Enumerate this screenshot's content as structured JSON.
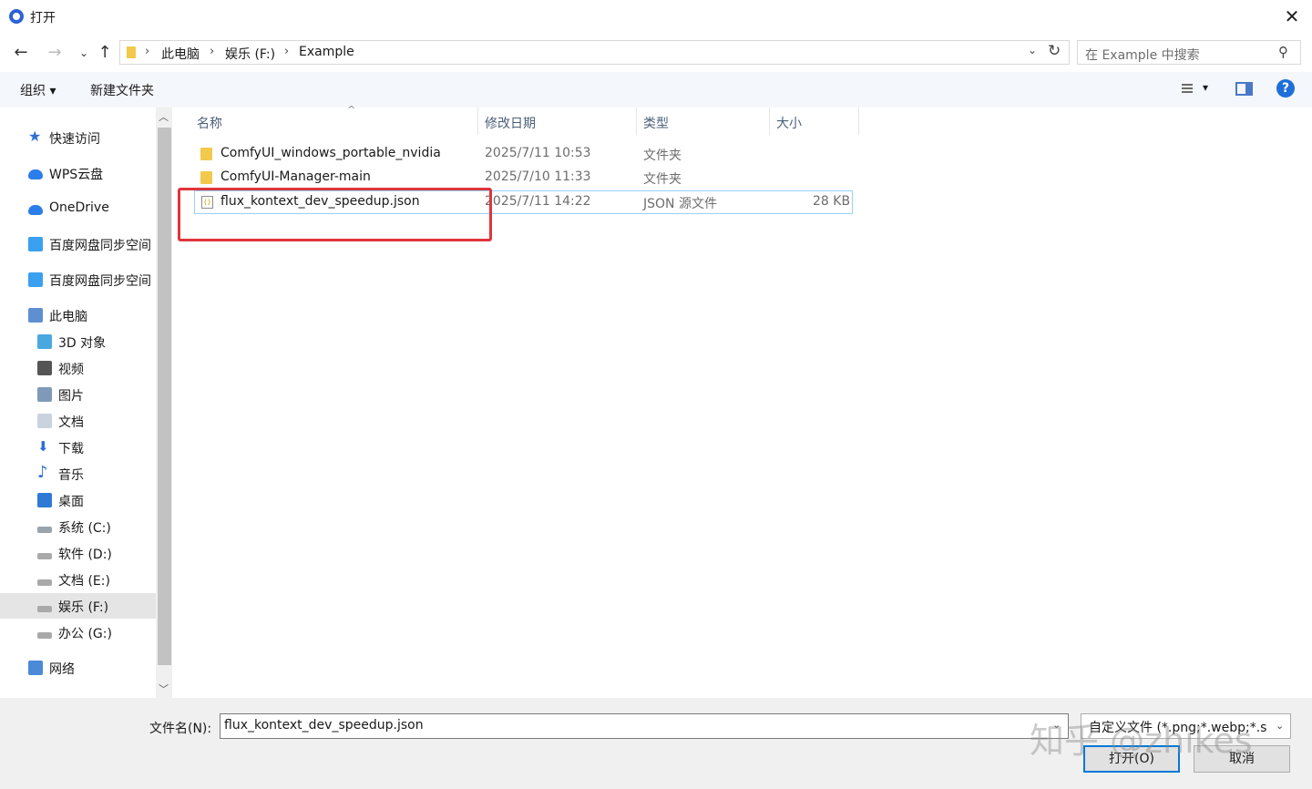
{
  "window": {
    "title": "打开"
  },
  "navigation": {
    "breadcrumbs": [
      "此电脑",
      "娱乐 (F:)",
      "Example"
    ],
    "search_placeholder": "在 Example 中搜索"
  },
  "toolbar": {
    "organize_label": "组织 ▾",
    "new_folder_label": "新建文件夹"
  },
  "sidebar": {
    "items": [
      {
        "label": "快速访问",
        "icon": "star-icon"
      },
      {
        "label": "WPS云盘",
        "icon": "cloud-icon"
      },
      {
        "label": "OneDrive",
        "icon": "cloud-icon"
      },
      {
        "label": "百度网盘同步空间",
        "icon": "baidu-netdisk-icon"
      },
      {
        "label": "百度网盘同步空间",
        "icon": "baidu-netdisk-icon"
      },
      {
        "label": "此电脑",
        "icon": "computer-icon"
      },
      {
        "label": "3D 对象",
        "icon": "cube-icon"
      },
      {
        "label": "视频",
        "icon": "film-icon"
      },
      {
        "label": "图片",
        "icon": "picture-icon"
      },
      {
        "label": "文档",
        "icon": "document-icon"
      },
      {
        "label": "下载",
        "icon": "download-arrow-icon"
      },
      {
        "label": "音乐",
        "icon": "music-note-icon"
      },
      {
        "label": "桌面",
        "icon": "desktop-icon"
      },
      {
        "label": "系统 (C:)",
        "icon": "windows-drive-icon"
      },
      {
        "label": "软件 (D:)",
        "icon": "drive-icon"
      },
      {
        "label": "文档 (E:)",
        "icon": "drive-icon"
      },
      {
        "label": "娱乐 (F:)",
        "icon": "drive-icon",
        "selected": true
      },
      {
        "label": "办公 (G:)",
        "icon": "drive-icon"
      },
      {
        "label": "网络",
        "icon": "network-icon"
      }
    ]
  },
  "file_list": {
    "columns": [
      "名称",
      "修改日期",
      "类型",
      "大小"
    ],
    "rows": [
      {
        "name": "ComfyUI_windows_portable_nvidia",
        "date": "2025/7/11 10:53",
        "type": "文件夹",
        "size": "",
        "icon": "folder-icon"
      },
      {
        "name": "ComfyUI-Manager-main",
        "date": "2025/7/10 11:33",
        "type": "文件夹",
        "size": "",
        "icon": "folder-icon"
      },
      {
        "name": "flux_kontext_dev_speedup.json",
        "date": "2025/7/11 14:22",
        "type": "JSON 源文件",
        "size": "28 KB",
        "icon": "json-file-icon",
        "selected": true
      }
    ]
  },
  "footer": {
    "filename_label": "文件名(N):",
    "filename_value": "flux_kontext_dev_speedup.json",
    "filter_value": "自定义文件 (*.png;*.webp;*.s",
    "open_label": "打开(O)",
    "cancel_label": "取消",
    "watermark": "知乎 @zhikes"
  },
  "colors": {
    "accent": "#0078d7",
    "highlight_box": "#e0343b",
    "folder": "#f2c94c"
  }
}
